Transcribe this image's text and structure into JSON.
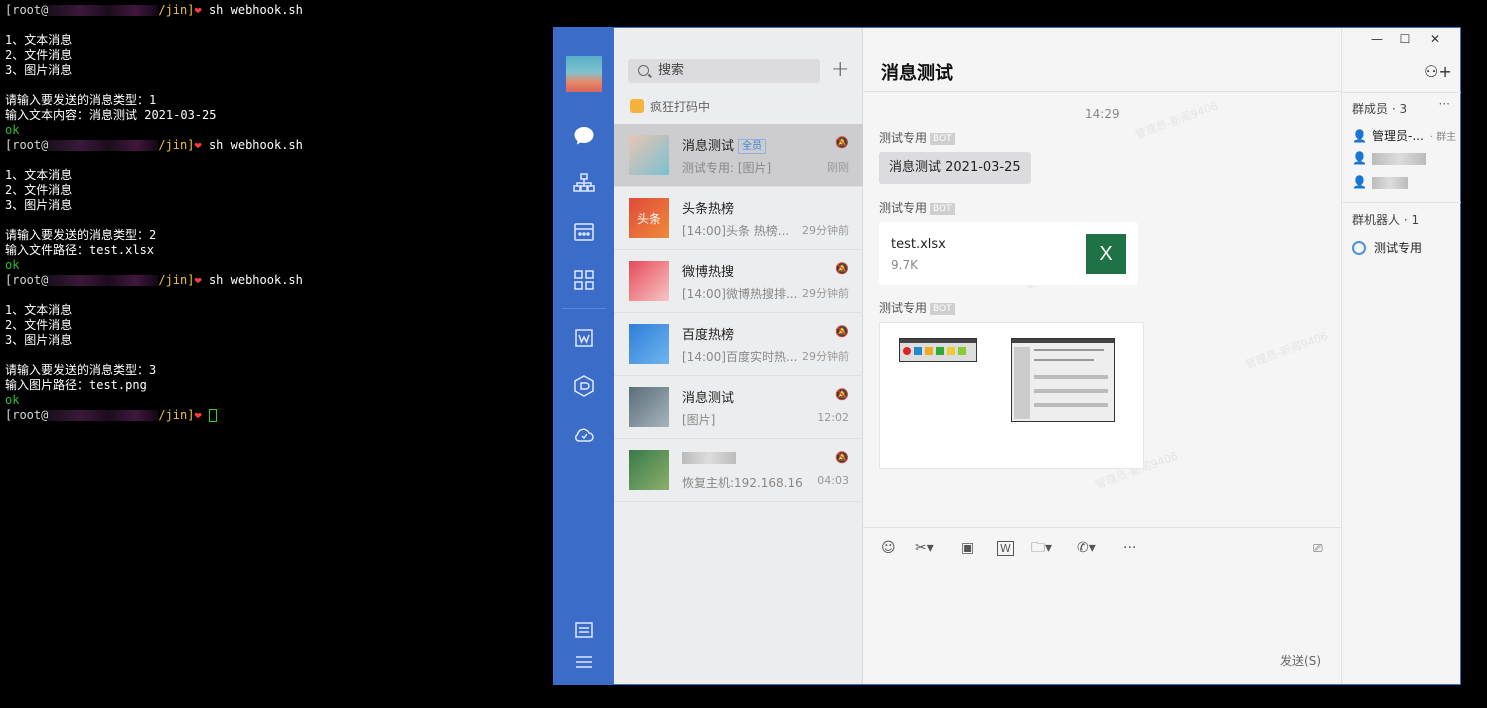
{
  "terminal": {
    "prompt_user": "root@",
    "prompt_path": "/jin]",
    "lines": [
      {
        "kind": "prompt",
        "cmd": " sh webhook.sh"
      },
      {
        "kind": "blank"
      },
      {
        "kind": "text",
        "text": "1、文本消息"
      },
      {
        "kind": "text",
        "text": "2、文件消息"
      },
      {
        "kind": "text",
        "text": "3、图片消息"
      },
      {
        "kind": "blank"
      },
      {
        "kind": "text",
        "text": "请输入要发送的消息类型：1"
      },
      {
        "kind": "text",
        "text": "输入文本内容：消息测试 2021-03-25"
      },
      {
        "kind": "ok",
        "text": "ok"
      },
      {
        "kind": "prompt",
        "cmd": " sh webhook.sh"
      },
      {
        "kind": "blank"
      },
      {
        "kind": "text",
        "text": "1、文本消息"
      },
      {
        "kind": "text",
        "text": "2、文件消息"
      },
      {
        "kind": "text",
        "text": "3、图片消息"
      },
      {
        "kind": "blank"
      },
      {
        "kind": "text",
        "text": "请输入要发送的消息类型：2"
      },
      {
        "kind": "text",
        "text": "输入文件路径：test.xlsx"
      },
      {
        "kind": "ok",
        "text": "ok"
      },
      {
        "kind": "prompt",
        "cmd": " sh webhook.sh"
      },
      {
        "kind": "blank"
      },
      {
        "kind": "text",
        "text": "1、文本消息"
      },
      {
        "kind": "text",
        "text": "2、文件消息"
      },
      {
        "kind": "text",
        "text": "3、图片消息"
      },
      {
        "kind": "blank"
      },
      {
        "kind": "text",
        "text": "请输入要发送的消息类型：3"
      },
      {
        "kind": "text",
        "text": "输入图片路径：test.png"
      },
      {
        "kind": "ok",
        "text": "ok"
      },
      {
        "kind": "prompt_cursor",
        "cmd": " "
      }
    ]
  },
  "nav": {
    "items": [
      "chat-icon",
      "org-icon",
      "calendar-icon",
      "apps-icon",
      "doc-icon",
      "cube-icon",
      "cloud-icon"
    ],
    "bottom": [
      "settings-icon",
      "menu-icon"
    ]
  },
  "list": {
    "search_placeholder": "搜索",
    "status": "疯狂打码中",
    "conversations": [
      {
        "name": "消息测试",
        "tag": "全员",
        "preview": "测试专用: [图片]",
        "time": "刚刚",
        "muted": true,
        "active": true,
        "colors": [
          "#e8c6b3",
          "#7bc0cf"
        ]
      },
      {
        "name": "头条热榜",
        "tag": "",
        "preview": "[14:00]头条 热榜...",
        "time": "29分钟前",
        "muted": false,
        "active": false,
        "colors": [
          "#e04a3a",
          "#f08a3a"
        ],
        "label": "头条"
      },
      {
        "name": "微博热搜",
        "tag": "",
        "preview": "[14:00]微博热搜排...",
        "time": "29分钟前",
        "muted": true,
        "active": false,
        "colors": [
          "#e64a5a",
          "#f7c6c6"
        ]
      },
      {
        "name": "百度热榜",
        "tag": "",
        "preview": "[14:00]百度实时热...",
        "time": "29分钟前",
        "muted": true,
        "active": false,
        "colors": [
          "#2f7fd8",
          "#6fb4f0"
        ]
      },
      {
        "name": "消息测试",
        "tag": "",
        "preview": "[图片]",
        "time": "12:02",
        "muted": true,
        "active": false,
        "colors": [
          "#5a6e7a",
          "#a8b4bc"
        ]
      },
      {
        "name": "",
        "tag": "",
        "preview": "恢复主机:192.168.16....",
        "time": "04:03",
        "muted": true,
        "active": false,
        "colors": [
          "#3a7a4a",
          "#8ab06a"
        ]
      }
    ]
  },
  "chat": {
    "title": "消息测试",
    "time": "14:29",
    "watermark": "管理员-新阁9406",
    "sender": "测试专用",
    "bot_label": "BOT",
    "text_message": "消息测试 2021-03-25",
    "file": {
      "name": "test.xlsx",
      "size": "9.7K",
      "icon": "X"
    },
    "toolbar": [
      "emoji-icon",
      "scissors-icon",
      "image-icon",
      "doc-w-icon",
      "folder-icon",
      "phone-icon",
      "more-icon"
    ],
    "send_label": "发送(S)"
  },
  "members": {
    "title": "群成员 · 3",
    "more": "···",
    "list": [
      {
        "name": "管理员-...",
        "role": "· 群主"
      },
      {
        "name": "",
        "role": ""
      },
      {
        "name": "",
        "role": ""
      }
    ],
    "robots_title": "群机器人 · 1",
    "robot": "测试专用"
  },
  "window_controls": [
    "—",
    "☐",
    "✕"
  ]
}
